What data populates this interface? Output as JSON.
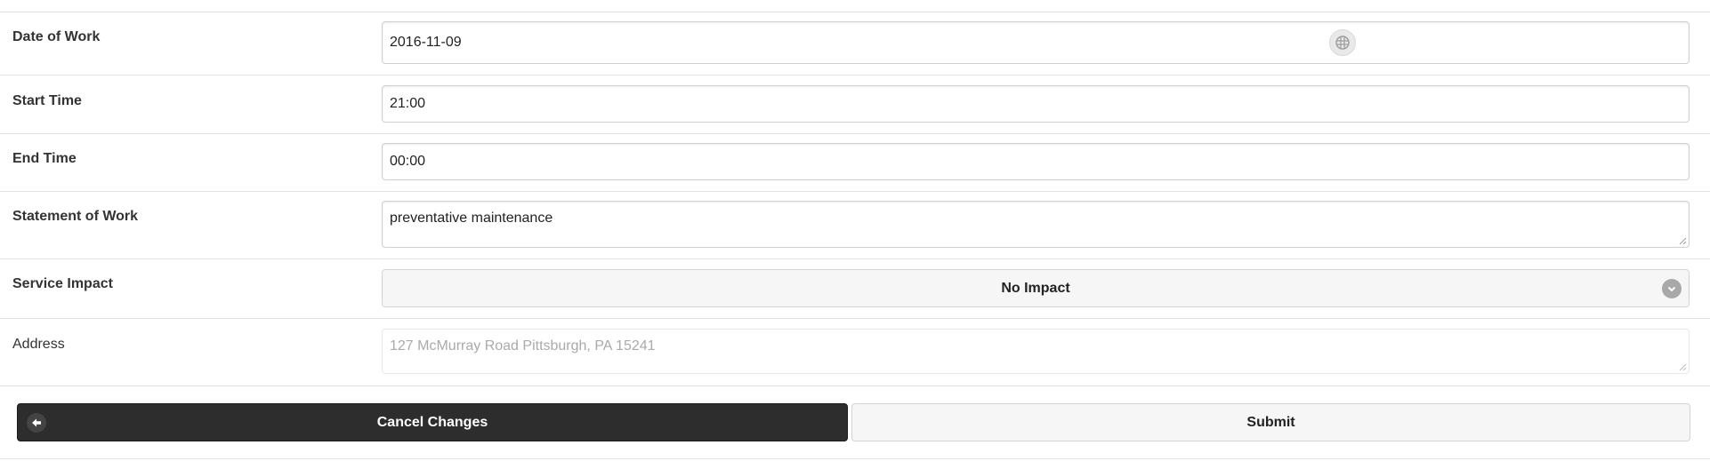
{
  "form": {
    "date_of_work": {
      "label": "Date of Work",
      "value": "2016-11-09"
    },
    "start_time": {
      "label": "Start Time",
      "value": "21:00"
    },
    "end_time": {
      "label": "End Time",
      "value": "00:00"
    },
    "statement_of_work": {
      "label": "Statement of Work",
      "value": "preventative maintenance"
    },
    "service_impact": {
      "label": "Service Impact",
      "value": "No Impact"
    },
    "address": {
      "label": "Address",
      "placeholder": "127 McMurray Road Pittsburgh, PA 15241"
    }
  },
  "actions": {
    "cancel_label": "Cancel Changes",
    "submit_label": "Submit"
  },
  "icons": {
    "calendar": "calendar-grid-icon",
    "select": "chevron-down-icon",
    "cancel": "arrow-left-icon"
  },
  "colors": {
    "cancel_button": "#2d2d2d",
    "submit_button": "#f6f6f6"
  }
}
